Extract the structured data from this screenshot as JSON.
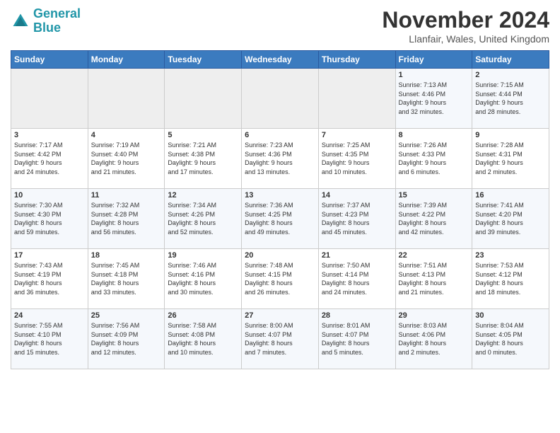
{
  "header": {
    "logo_line1": "General",
    "logo_line2": "Blue",
    "month_title": "November 2024",
    "location": "Llanfair, Wales, United Kingdom"
  },
  "days_of_week": [
    "Sunday",
    "Monday",
    "Tuesday",
    "Wednesday",
    "Thursday",
    "Friday",
    "Saturday"
  ],
  "weeks": [
    [
      {
        "day": "",
        "info": ""
      },
      {
        "day": "",
        "info": ""
      },
      {
        "day": "",
        "info": ""
      },
      {
        "day": "",
        "info": ""
      },
      {
        "day": "",
        "info": ""
      },
      {
        "day": "1",
        "info": "Sunrise: 7:13 AM\nSunset: 4:46 PM\nDaylight: 9 hours\nand 32 minutes."
      },
      {
        "day": "2",
        "info": "Sunrise: 7:15 AM\nSunset: 4:44 PM\nDaylight: 9 hours\nand 28 minutes."
      }
    ],
    [
      {
        "day": "3",
        "info": "Sunrise: 7:17 AM\nSunset: 4:42 PM\nDaylight: 9 hours\nand 24 minutes."
      },
      {
        "day": "4",
        "info": "Sunrise: 7:19 AM\nSunset: 4:40 PM\nDaylight: 9 hours\nand 21 minutes."
      },
      {
        "day": "5",
        "info": "Sunrise: 7:21 AM\nSunset: 4:38 PM\nDaylight: 9 hours\nand 17 minutes."
      },
      {
        "day": "6",
        "info": "Sunrise: 7:23 AM\nSunset: 4:36 PM\nDaylight: 9 hours\nand 13 minutes."
      },
      {
        "day": "7",
        "info": "Sunrise: 7:25 AM\nSunset: 4:35 PM\nDaylight: 9 hours\nand 10 minutes."
      },
      {
        "day": "8",
        "info": "Sunrise: 7:26 AM\nSunset: 4:33 PM\nDaylight: 9 hours\nand 6 minutes."
      },
      {
        "day": "9",
        "info": "Sunrise: 7:28 AM\nSunset: 4:31 PM\nDaylight: 9 hours\nand 2 minutes."
      }
    ],
    [
      {
        "day": "10",
        "info": "Sunrise: 7:30 AM\nSunset: 4:30 PM\nDaylight: 8 hours\nand 59 minutes."
      },
      {
        "day": "11",
        "info": "Sunrise: 7:32 AM\nSunset: 4:28 PM\nDaylight: 8 hours\nand 56 minutes."
      },
      {
        "day": "12",
        "info": "Sunrise: 7:34 AM\nSunset: 4:26 PM\nDaylight: 8 hours\nand 52 minutes."
      },
      {
        "day": "13",
        "info": "Sunrise: 7:36 AM\nSunset: 4:25 PM\nDaylight: 8 hours\nand 49 minutes."
      },
      {
        "day": "14",
        "info": "Sunrise: 7:37 AM\nSunset: 4:23 PM\nDaylight: 8 hours\nand 45 minutes."
      },
      {
        "day": "15",
        "info": "Sunrise: 7:39 AM\nSunset: 4:22 PM\nDaylight: 8 hours\nand 42 minutes."
      },
      {
        "day": "16",
        "info": "Sunrise: 7:41 AM\nSunset: 4:20 PM\nDaylight: 8 hours\nand 39 minutes."
      }
    ],
    [
      {
        "day": "17",
        "info": "Sunrise: 7:43 AM\nSunset: 4:19 PM\nDaylight: 8 hours\nand 36 minutes."
      },
      {
        "day": "18",
        "info": "Sunrise: 7:45 AM\nSunset: 4:18 PM\nDaylight: 8 hours\nand 33 minutes."
      },
      {
        "day": "19",
        "info": "Sunrise: 7:46 AM\nSunset: 4:16 PM\nDaylight: 8 hours\nand 30 minutes."
      },
      {
        "day": "20",
        "info": "Sunrise: 7:48 AM\nSunset: 4:15 PM\nDaylight: 8 hours\nand 26 minutes."
      },
      {
        "day": "21",
        "info": "Sunrise: 7:50 AM\nSunset: 4:14 PM\nDaylight: 8 hours\nand 24 minutes."
      },
      {
        "day": "22",
        "info": "Sunrise: 7:51 AM\nSunset: 4:13 PM\nDaylight: 8 hours\nand 21 minutes."
      },
      {
        "day": "23",
        "info": "Sunrise: 7:53 AM\nSunset: 4:12 PM\nDaylight: 8 hours\nand 18 minutes."
      }
    ],
    [
      {
        "day": "24",
        "info": "Sunrise: 7:55 AM\nSunset: 4:10 PM\nDaylight: 8 hours\nand 15 minutes."
      },
      {
        "day": "25",
        "info": "Sunrise: 7:56 AM\nSunset: 4:09 PM\nDaylight: 8 hours\nand 12 minutes."
      },
      {
        "day": "26",
        "info": "Sunrise: 7:58 AM\nSunset: 4:08 PM\nDaylight: 8 hours\nand 10 minutes."
      },
      {
        "day": "27",
        "info": "Sunrise: 8:00 AM\nSunset: 4:07 PM\nDaylight: 8 hours\nand 7 minutes."
      },
      {
        "day": "28",
        "info": "Sunrise: 8:01 AM\nSunset: 4:07 PM\nDaylight: 8 hours\nand 5 minutes."
      },
      {
        "day": "29",
        "info": "Sunrise: 8:03 AM\nSunset: 4:06 PM\nDaylight: 8 hours\nand 2 minutes."
      },
      {
        "day": "30",
        "info": "Sunrise: 8:04 AM\nSunset: 4:05 PM\nDaylight: 8 hours\nand 0 minutes."
      }
    ]
  ]
}
